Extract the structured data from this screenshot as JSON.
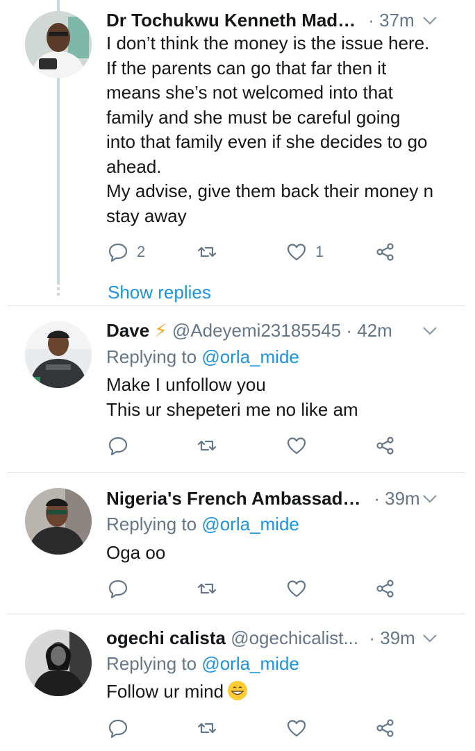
{
  "tweets": [
    {
      "name": "Dr Tochukwu Kenneth Maduka",
      "time": "· 37m",
      "lines": [
        "I don’t think the money is the issue here.",
        "If the parents can go that far then it",
        "means she’s not welcomed into that",
        "family and she must be careful going",
        "into that family even if she decides to go",
        "ahead.",
        "My advise, give them back their money n",
        "stay away"
      ],
      "reply_count": "2",
      "like_count": "1",
      "show_replies": "Show replies"
    },
    {
      "name": "Dave",
      "handle": "@Adeyemi23185545",
      "time": "· 42m",
      "replying_prefix": "Replying to",
      "replying_handle": "@orla_mide",
      "lines": [
        "Make I unfollow you",
        "This ur shepeteri me no like am"
      ]
    },
    {
      "name": "Nigeria's French Ambassado...",
      "time": "· 39m",
      "replying_prefix": "Replying to",
      "replying_handle": "@orla_mide",
      "lines": [
        "Oga oo"
      ]
    },
    {
      "name": "ogechi calista",
      "handle": "@ogechicalist...",
      "time": "· 39m",
      "replying_prefix": "Replying to",
      "replying_handle": "@orla_mide",
      "lines": [
        "Follow ur mind"
      ]
    }
  ],
  "colors": {
    "link": "#1b95e0",
    "muted": "#657786",
    "text": "#14171a",
    "divider": "#e1e8ed"
  },
  "icons": [
    "reply-icon",
    "retweet-icon",
    "like-icon",
    "share-icon",
    "caret-down-icon",
    "lightning-icon",
    "grinning-emoji-icon"
  ]
}
